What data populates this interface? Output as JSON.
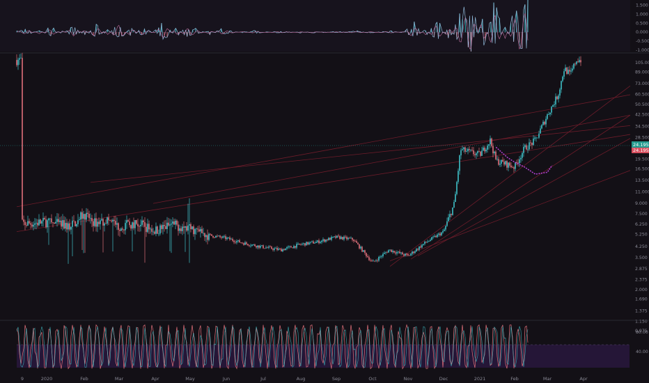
{
  "colors": {
    "background": "#131016",
    "pane_bg": "#17131d",
    "divider": "#2a2a33",
    "up": "#3fc1c9",
    "down": "#e0707a",
    "projection": "#b040d0",
    "trendline": "#6e1c2a",
    "axis_text": "#8a8a96",
    "last_price_bg": "#239a8e",
    "prev_price_bg": "#d74e5e",
    "stoch_fill": "#2a1840"
  },
  "chart_data": [
    {
      "type": "line",
      "pane": "oscillator",
      "series": [
        {
          "values": [
            0.05,
            0.15,
            -0.12,
            0.25,
            -0.1,
            0.3,
            -0.15,
            0.4,
            -0.2,
            0.6,
            -0.3,
            0.2,
            0.0,
            0.5,
            -0.25,
            0.3,
            0.1,
            -0.1,
            0.15,
            0.05,
            -0.05,
            0.08,
            -0.02,
            0.04,
            0.02,
            -0.03,
            0.05,
            -0.02,
            0.03,
            0.01,
            0.06,
            -0.04,
            0.02,
            0.05,
            -0.03,
            0.4,
            -0.2,
            0.6,
            -0.4,
            0.8,
            1.5,
            -1.0,
            1.6,
            -0.5,
            1.3,
            1.6
          ]
        }
      ],
      "y_ticks": [
        1.5,
        1.0,
        0.5,
        0.0,
        -0.5,
        -1.0
      ],
      "y_tick_labels": [
        "1.500",
        "1.000",
        "0.500",
        "0.000",
        "-0.500",
        "-1.000"
      ],
      "ylim": [
        -1.0,
        1.6
      ]
    },
    {
      "type": "candlestick",
      "pane": "price",
      "scale": "log",
      "x_ticks": [
        "9",
        "2020",
        "Feb",
        "Mar",
        "Apr",
        "May",
        "Jun",
        "Jul",
        "Aug",
        "Sep",
        "Oct",
        "Nov",
        "Dec",
        "2021",
        "Feb",
        "Mar",
        "Apr"
      ],
      "y_tick_labels": [
        "105.000",
        "89.000",
        "73.000",
        "60.500",
        "50.500",
        "42.500",
        "34.500",
        "28.500",
        "23.500",
        "19.500",
        "16.500",
        "13.500",
        "11.000",
        "9.000",
        "7.500",
        "6.250",
        "5.250",
        "4.250",
        "3.500",
        "2.875",
        "2.375",
        "2.000",
        "1.690",
        "1.375",
        "1.150",
        "0.975"
      ],
      "y_tick_values": [
        105,
        89,
        73,
        60.5,
        50.5,
        42.5,
        34.5,
        28.5,
        23.5,
        19.5,
        16.5,
        13.5,
        11,
        9,
        7.5,
        6.25,
        5.25,
        4.25,
        3.5,
        2.875,
        2.375,
        2.0,
        1.69,
        1.375,
        1.15,
        0.975
      ],
      "close_path": [
        {
          "x": "Jan 9",
          "y": 6.3
        },
        {
          "x": "2020",
          "y": 6.5
        },
        {
          "x": "Jan 20",
          "y": 6.0
        },
        {
          "x": "Feb",
          "y": 7.5
        },
        {
          "x": "Feb 10",
          "y": 6.4
        },
        {
          "x": "Feb 20",
          "y": 6.8
        },
        {
          "x": "Mar",
          "y": 6.0
        },
        {
          "x": "Mar 15",
          "y": 6.4
        },
        {
          "x": "Apr",
          "y": 5.6
        },
        {
          "x": "Apr 15",
          "y": 6.2
        },
        {
          "x": "May",
          "y": 5.8
        },
        {
          "x": "May 15",
          "y": 5.2
        },
        {
          "x": "Jun",
          "y": 4.9
        },
        {
          "x": "Jun 15",
          "y": 4.5
        },
        {
          "x": "Jul",
          "y": 4.2
        },
        {
          "x": "Jul 15",
          "y": 4.0
        },
        {
          "x": "Aug",
          "y": 4.4
        },
        {
          "x": "Aug 15",
          "y": 4.6
        },
        {
          "x": "Sep",
          "y": 5.0
        },
        {
          "x": "Sep 15",
          "y": 4.8
        },
        {
          "x": "Oct",
          "y": 3.2
        },
        {
          "x": "Oct 15",
          "y": 4.0
        },
        {
          "x": "Nov",
          "y": 3.6
        },
        {
          "x": "Nov 15",
          "y": 4.5
        },
        {
          "x": "Dec",
          "y": 5.5
        },
        {
          "x": "Dec 10",
          "y": 9.0
        },
        {
          "x": "Dec 15",
          "y": 23.0
        },
        {
          "x": "2021",
          "y": 21.0
        },
        {
          "x": "Jan 10",
          "y": 27.0
        },
        {
          "x": "Jan 15",
          "y": 19.0
        },
        {
          "x": "Feb",
          "y": 17.0
        },
        {
          "x": "Feb 10",
          "y": 23.5
        },
        {
          "x": "Feb 20",
          "y": 27.0
        },
        {
          "x": "Mar",
          "y": 42.0
        },
        {
          "x": "Mar 10",
          "y": 60.0
        },
        {
          "x": "Mar 15",
          "y": 95.0
        },
        {
          "x": "Mar 20",
          "y": 85.0
        },
        {
          "x": "Mar 25",
          "y": 110.0
        }
      ],
      "projection": [
        {
          "x": "Jan 15",
          "y": 24.0
        },
        {
          "x": "Jan 25",
          "y": 20.0
        },
        {
          "x": "Feb",
          "y": 18.5
        },
        {
          "x": "Feb 10",
          "y": 17.0
        },
        {
          "x": "Feb 20",
          "y": 15.0
        },
        {
          "x": "Mar",
          "y": 15.5
        },
        {
          "x": "Mar 5",
          "y": 17.5
        }
      ],
      "last_price": "24.195",
      "prev_price": "24.195"
    },
    {
      "type": "area",
      "pane": "stochastic",
      "y_ticks": [
        80,
        40
      ],
      "y_tick_labels": [
        "80.00",
        "40.00"
      ],
      "ylim": [
        0,
        100
      ]
    }
  ]
}
